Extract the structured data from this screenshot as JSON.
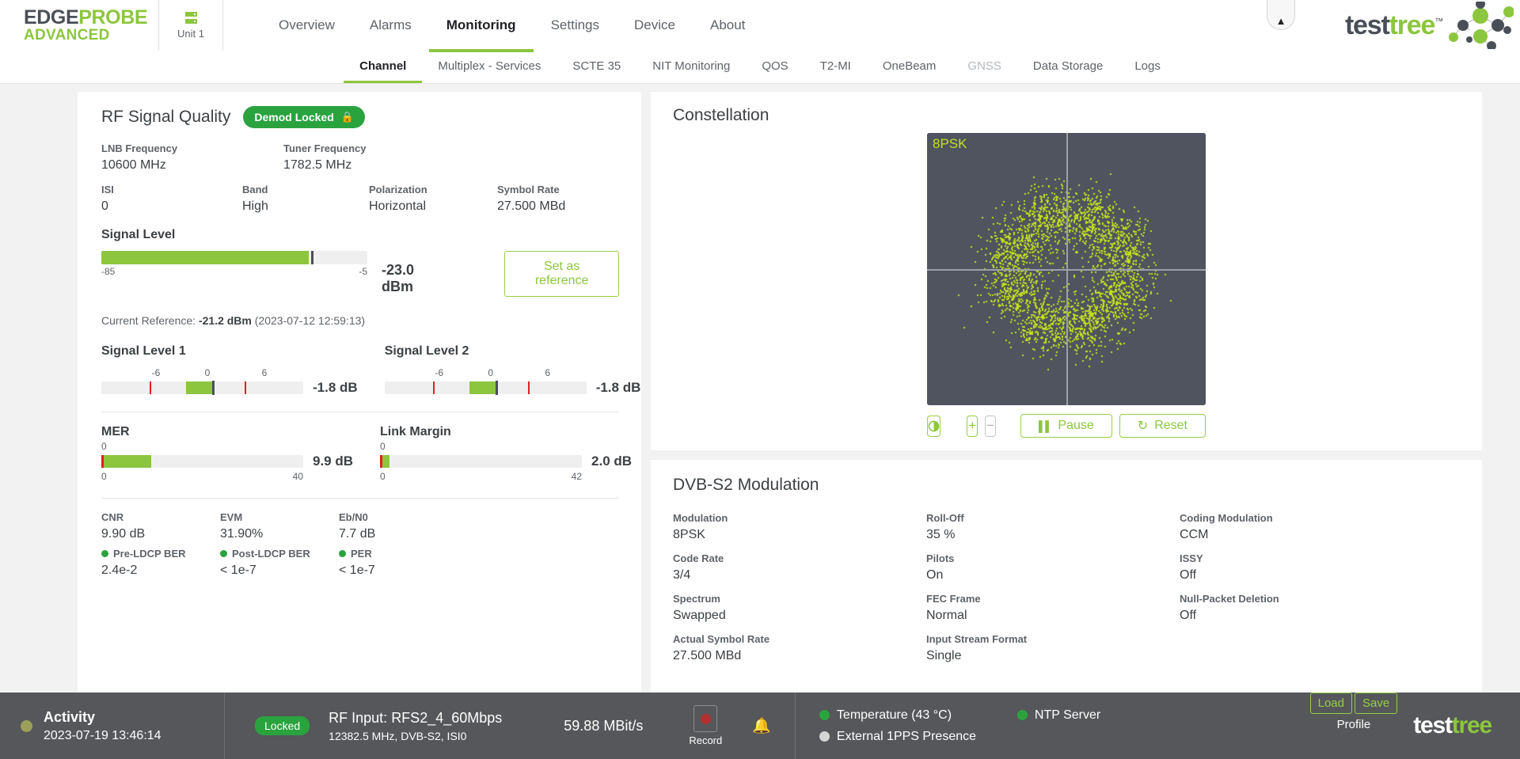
{
  "header": {
    "brand_line1_a": "EDGE",
    "brand_line1_b": "PROBE",
    "brand_line2": "ADVANCED",
    "unit_label": "Unit 1",
    "unit_icon": "server-rack-icon",
    "collapse_icon": "chevron-up-icon",
    "logo_test": "test",
    "logo_tree": "tree",
    "logo_tm": "™",
    "nav": [
      {
        "label": "Overview",
        "active": false
      },
      {
        "label": "Alarms",
        "active": false
      },
      {
        "label": "Monitoring",
        "active": true
      },
      {
        "label": "Settings",
        "active": false
      },
      {
        "label": "Device",
        "active": false
      },
      {
        "label": "About",
        "active": false
      }
    ],
    "subnav": [
      {
        "label": "Channel",
        "active": true,
        "disabled": false
      },
      {
        "label": "Multiplex - Services",
        "active": false,
        "disabled": false
      },
      {
        "label": "SCTE 35",
        "active": false,
        "disabled": false
      },
      {
        "label": "NIT Monitoring",
        "active": false,
        "disabled": false
      },
      {
        "label": "QOS",
        "active": false,
        "disabled": false
      },
      {
        "label": "T2-MI",
        "active": false,
        "disabled": false
      },
      {
        "label": "OneBeam",
        "active": false,
        "disabled": false
      },
      {
        "label": "GNSS",
        "active": false,
        "disabled": true
      },
      {
        "label": "Data Storage",
        "active": false,
        "disabled": false
      },
      {
        "label": "Logs",
        "active": false,
        "disabled": false
      }
    ]
  },
  "rf": {
    "title": "RF Signal Quality",
    "status_badge": "Demod Locked",
    "lock_icon": "lock-icon",
    "fields": {
      "lnb_frequency_label": "LNB Frequency",
      "lnb_frequency_value": "10600 MHz",
      "tuner_frequency_label": "Tuner Frequency",
      "tuner_frequency_value": "1782.5 MHz",
      "isi_label": "ISI",
      "isi_value": "0",
      "band_label": "Band",
      "band_value": "High",
      "polarization_label": "Polarization",
      "polarization_value": "Horizontal",
      "symbol_rate_label": "Symbol Rate",
      "symbol_rate_value": "27.500 MBd"
    },
    "signal_level": {
      "label": "Signal Level",
      "value": "-23.0 dBm",
      "min": "-85",
      "max": "-5",
      "fill_percent": 78,
      "cursor_percent": 79,
      "set_reference_button": "Set as reference",
      "reference_prefix": "Current Reference:",
      "reference_value": "-21.2 dBm",
      "reference_timestamp": "(2023-07-12 12:59:13)"
    },
    "signal_level_1": {
      "label": "Signal Level 1",
      "value": "-1.8 dB",
      "ticks": [
        "-6",
        "0",
        "6"
      ],
      "tick_positions": [
        20,
        50,
        80
      ],
      "red_marks": [
        20,
        80
      ],
      "green_start": 40,
      "green_width": 13,
      "cursor": 53
    },
    "signal_level_2": {
      "label": "Signal Level 2",
      "value": "-1.8 dB",
      "ticks": [
        "-6",
        "0",
        "6"
      ],
      "tick_positions": [
        20,
        50,
        80
      ],
      "red_marks": [
        20,
        80
      ],
      "green_start": 40,
      "green_width": 13,
      "cursor": 53
    },
    "mer": {
      "label": "MER",
      "value": "9.9 dB",
      "min": "0",
      "max": "40",
      "top_zero": "0",
      "fill_percent": 24.8
    },
    "link_margin": {
      "label": "Link Margin",
      "value": "2.0 dB",
      "min": "0",
      "max": "42",
      "top_zero": "0",
      "fill_percent": 4.8
    },
    "metrics": [
      {
        "label": "CNR",
        "value": "9.90 dB"
      },
      {
        "label": "EVM",
        "value": "31.90%"
      },
      {
        "label": "Eb/N0",
        "value": "7.7 dB"
      }
    ],
    "ber": [
      {
        "label": "Pre-LDCP BER",
        "value": "2.4e-2",
        "status": "green"
      },
      {
        "label": "Post-LDCP BER",
        "value": "< 1e-7",
        "status": "green"
      },
      {
        "label": "PER",
        "value": "< 1e-7",
        "status": "green"
      }
    ]
  },
  "constellation": {
    "title": "Constellation",
    "plot_label": "8PSK",
    "plot_bg_color": "#4f545e",
    "point_color": "#c3e020",
    "buttons": {
      "contrast_icon": "contrast-icon",
      "zoom_in": "+",
      "zoom_out": "−",
      "pause_icon": "pause-icon",
      "pause": "Pause",
      "reset_icon": "refresh-icon",
      "reset": "Reset"
    },
    "chart_data": {
      "type": "scatter",
      "title": "8PSK",
      "modulation": "8PSK",
      "clusters": 8,
      "cluster_angles_deg": [
        22.5,
        67.5,
        112.5,
        157.5,
        202.5,
        247.5,
        292.5,
        337.5
      ],
      "ring_radius_norm": 0.42,
      "cluster_spread_norm": 0.115,
      "points_per_cluster": 330,
      "xlim": [
        -1,
        1
      ],
      "ylim": [
        -1,
        1
      ],
      "grid": "crosshair-axes"
    }
  },
  "dvb": {
    "title": "DVB-S2 Modulation",
    "cells": [
      {
        "label": "Modulation",
        "value": "8PSK"
      },
      {
        "label": "Roll-Off",
        "value": "35 %"
      },
      {
        "label": "Coding Modulation",
        "value": "CCM"
      },
      {
        "label": "Code Rate",
        "value": "3/4"
      },
      {
        "label": "Pilots",
        "value": "On"
      },
      {
        "label": "ISSY",
        "value": "Off"
      },
      {
        "label": "Spectrum",
        "value": "Swapped"
      },
      {
        "label": "FEC Frame",
        "value": "Normal"
      },
      {
        "label": "Null-Packet Deletion",
        "value": "Off"
      },
      {
        "label": "Actual Symbol Rate",
        "value": "27.500 MBd"
      },
      {
        "label": "Input Stream Format",
        "value": "Single"
      },
      {
        "label": "",
        "value": ""
      }
    ]
  },
  "footer": {
    "activity_label": "Activity",
    "activity_time": "2023-07-19 13:46:14",
    "activity_dot_color": "#9aa05a",
    "locked_badge": "Locked",
    "rf_input": "RF Input: RFS2_4_60Mbps",
    "rf_details": "12382.5 MHz, DVB-S2, ISI0",
    "bitrate": "59.88 MBit/s",
    "record_label": "Record",
    "record_icon": "record-dot-icon",
    "bell_icon": "bell-icon",
    "status": [
      {
        "label": "Temperature (43 °C)",
        "color": "#2aa33f"
      },
      {
        "label": "NTP Server",
        "color": "#2aa33f"
      },
      {
        "label": "External 1PPS Presence",
        "color": "#d5d5d5"
      }
    ],
    "profile_load": "Load",
    "profile_save": "Save",
    "profile_label": "Profile",
    "logo_test": "test",
    "logo_tree": "tree"
  }
}
